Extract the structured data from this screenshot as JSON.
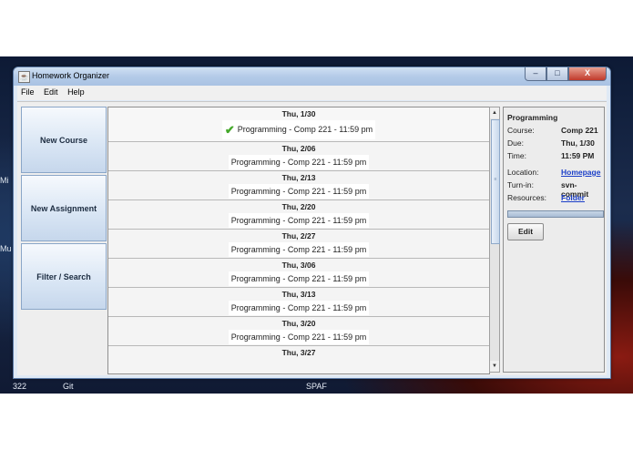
{
  "window": {
    "title": "Homework Organizer",
    "controls": {
      "minimize": "‒",
      "maximize": "□",
      "close": "X"
    }
  },
  "menu": [
    "File",
    "Edit",
    "Help"
  ],
  "sidebar": {
    "buttons": [
      "New Course",
      "New Assignment",
      "Filter / Search"
    ]
  },
  "assignments": [
    {
      "date": "Thu, 1/30",
      "description": "Programming - Comp 221 - 11:59 pm",
      "completed": true
    },
    {
      "date": "Thu, 2/06",
      "description": "Programming - Comp 221 - 11:59 pm",
      "completed": false
    },
    {
      "date": "Thu, 2/13",
      "description": "Programming - Comp 221 - 11:59 pm",
      "completed": false
    },
    {
      "date": "Thu, 2/20",
      "description": "Programming - Comp 221 - 11:59 pm",
      "completed": false
    },
    {
      "date": "Thu, 2/27",
      "description": "Programming - Comp 221 - 11:59 pm",
      "completed": false
    },
    {
      "date": "Thu, 3/06",
      "description": "Programming - Comp 221 - 11:59 pm",
      "completed": false
    },
    {
      "date": "Thu, 3/13",
      "description": "Programming - Comp 221 - 11:59 pm",
      "completed": false
    },
    {
      "date": "Thu, 3/20",
      "description": "Programming - Comp 221 - 11:59 pm",
      "completed": false
    },
    {
      "date": "Thu, 3/27",
      "description": "",
      "completed": false
    }
  ],
  "details": {
    "title": "Programming",
    "course_label": "Course:",
    "course_value": "Comp 221",
    "due_label": "Due:",
    "due_value": "Thu, 1/30",
    "time_label": "Time:",
    "time_value": "11:59 PM",
    "location_label": "Location:",
    "location_value": "Homepage",
    "turnin_label": "Turn-in:",
    "turnin_value": "svn-commit",
    "resources_label": "Resources:",
    "resources_value": "Folder",
    "edit_label": "Edit"
  },
  "desktop": {
    "left_labels": [
      "Mi",
      "Mu"
    ],
    "taskbar": [
      "322",
      "Git",
      "SPAF"
    ]
  },
  "colors": {
    "link": "#1a3ec8",
    "check": "#44a82a",
    "titlebar": "#b4cbe8"
  }
}
